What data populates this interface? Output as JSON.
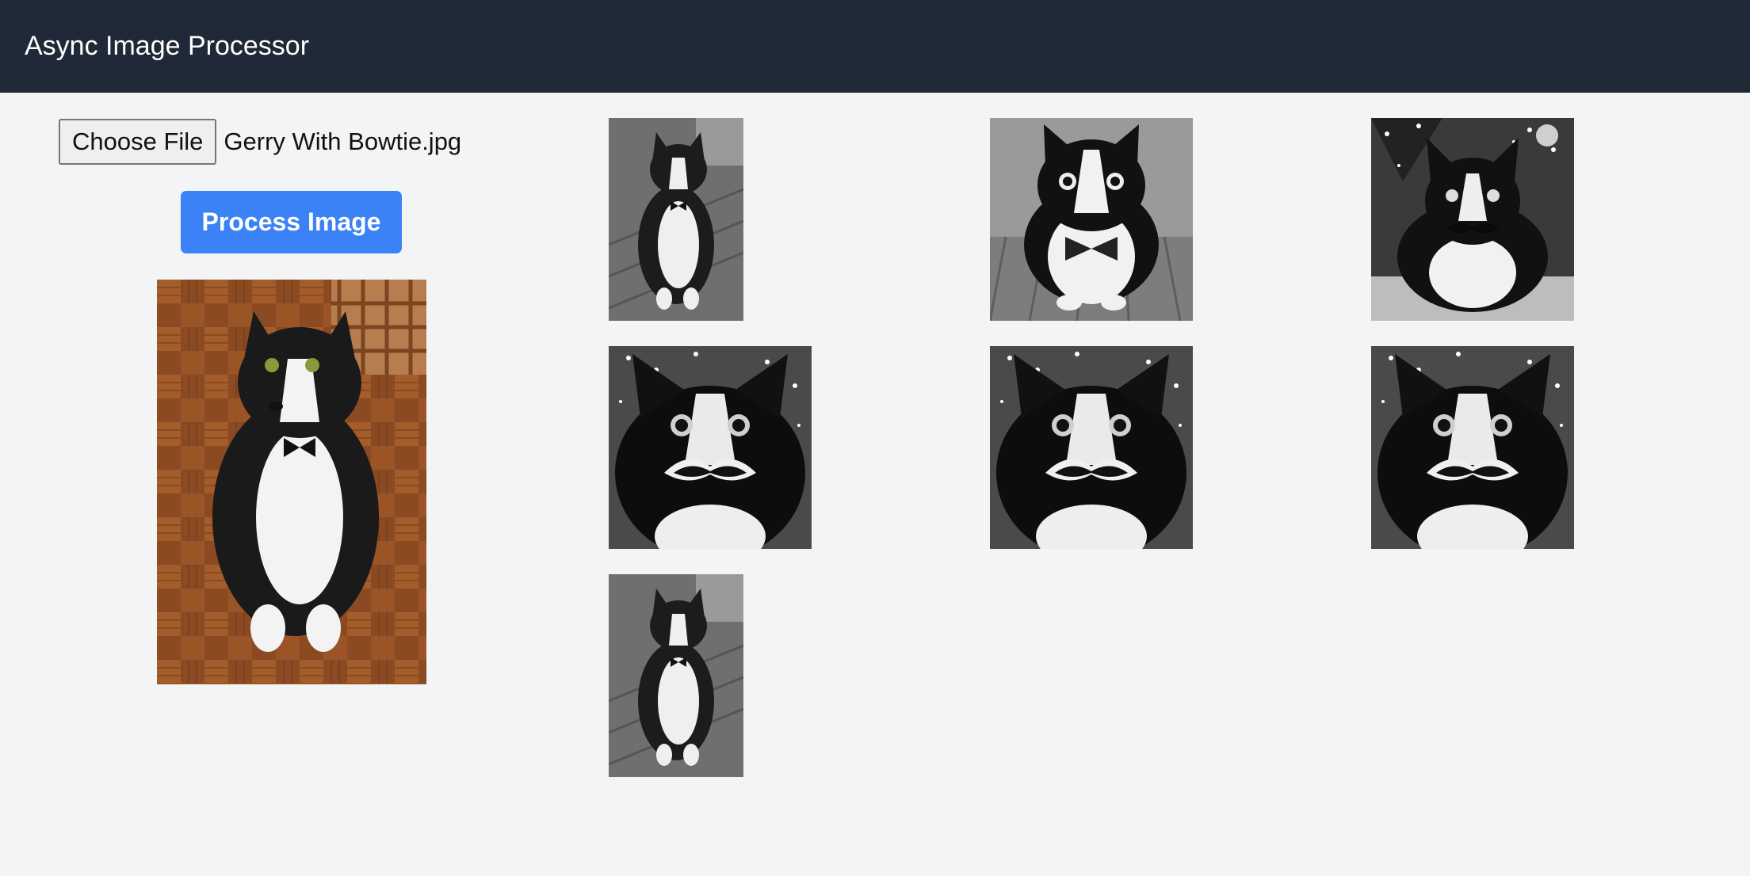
{
  "header": {
    "title": "Async Image Processor"
  },
  "upload": {
    "choose_file_label": "Choose File",
    "file_name": "Gerry With Bowtie.jpg",
    "process_button_label": "Process Image"
  },
  "original_image": {
    "subject": "tuxedo cat with bowtie on parquet floor",
    "style": "color photo"
  },
  "results": [
    {
      "subject": "tuxedo cat with bowtie, full body",
      "style": "grayscale"
    },
    {
      "subject": "cartoon tuxedo cat with bowtie",
      "style": "grayscale"
    },
    {
      "subject": "tuxedo cat with mustache, christmas tree",
      "style": "grayscale"
    },
    {
      "subject": "tuxedo cat with mustache close-up, christmas tree",
      "style": "grayscale"
    },
    {
      "subject": "tuxedo cat with mustache close-up, christmas tree",
      "style": "grayscale"
    },
    {
      "subject": "tuxedo cat with mustache close-up, christmas tree",
      "style": "grayscale"
    },
    {
      "subject": "tuxedo cat with bowtie, full body",
      "style": "grayscale"
    }
  ],
  "colors": {
    "header_bg": "#1f2937",
    "page_bg": "#f3f4f6",
    "accent": "#3b82f6"
  }
}
